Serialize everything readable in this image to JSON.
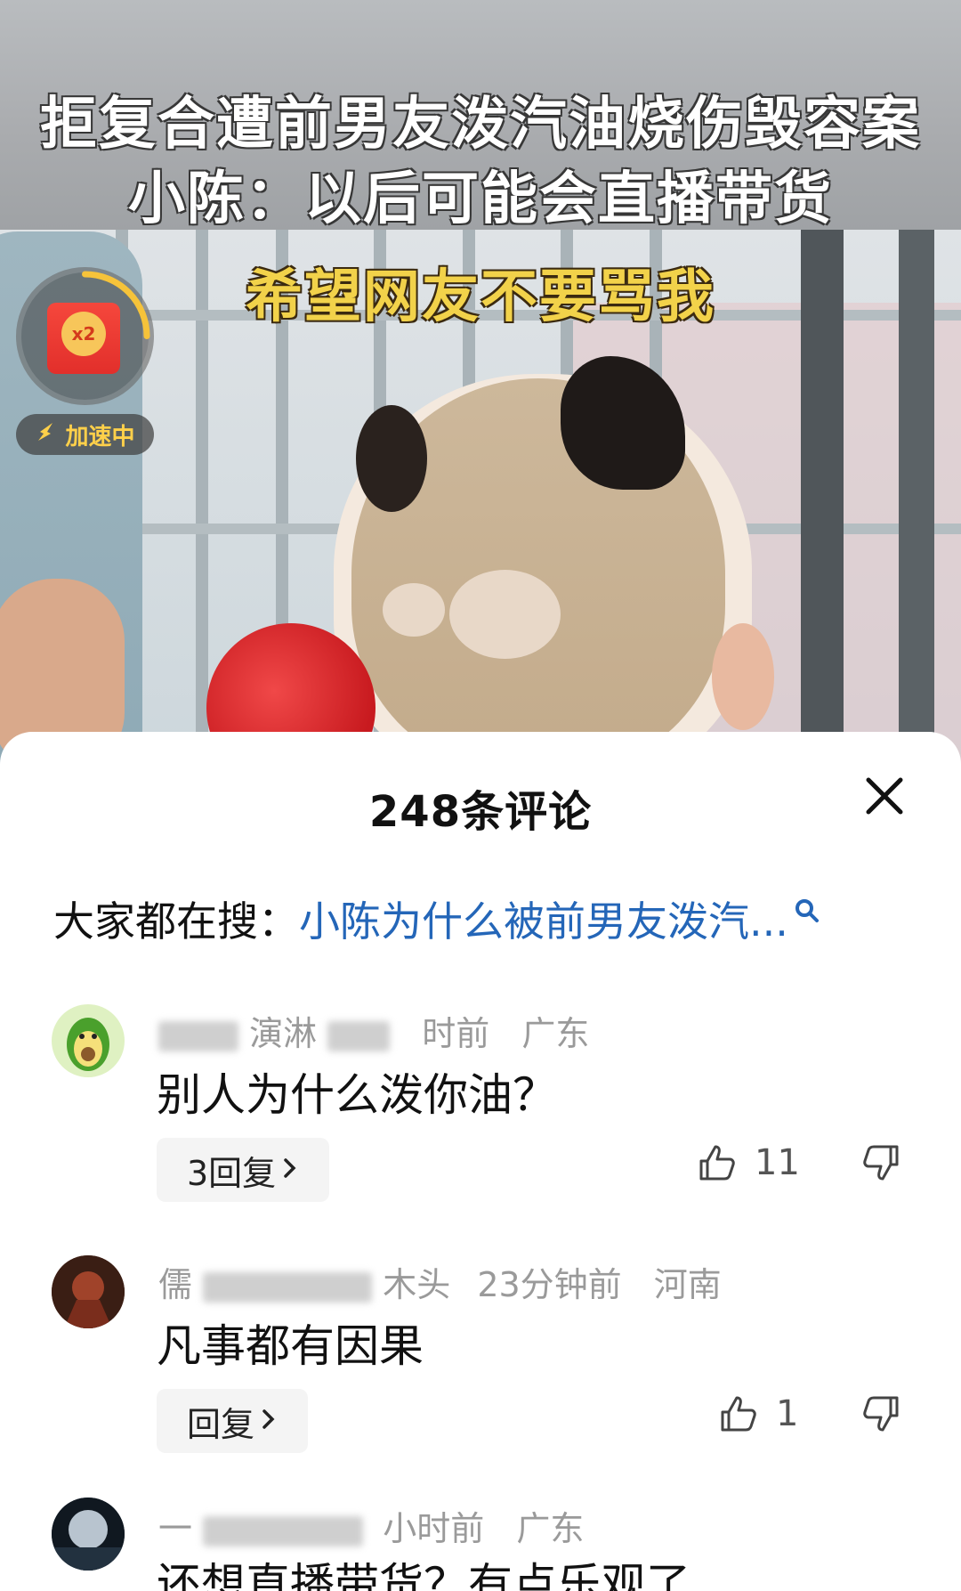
{
  "video": {
    "title_line1": "拒复合遭前男友泼汽油烧伤毁容案",
    "title_line2": "小陈：以后可能会直播带货",
    "subtitle": "希望网友不要骂我",
    "reward": {
      "multiplier": "x2",
      "status": "加速中"
    }
  },
  "sheet": {
    "title": "248条评论",
    "search_prefix": "大家都在搜：",
    "search_query": "小陈为什么被前男友泼汽..."
  },
  "comments": [
    {
      "user_visible": "演淋",
      "time": "时前",
      "region": "广东",
      "text": "别人为什么泼你油？",
      "reply_label": "3回复",
      "likes": "11"
    },
    {
      "user_visible_start": "儒",
      "user_visible_end": "木头",
      "time": "23分钟前",
      "region": "河南",
      "text": "凡事都有因果",
      "reply_label": "回复",
      "likes": "1"
    },
    {
      "user_visible": "一",
      "time": "小时前",
      "region": "广东",
      "text": "还想直播带货？有点乐观了"
    }
  ],
  "colors": {
    "link": "#2466b8",
    "accent_gold": "#f2d24a"
  }
}
